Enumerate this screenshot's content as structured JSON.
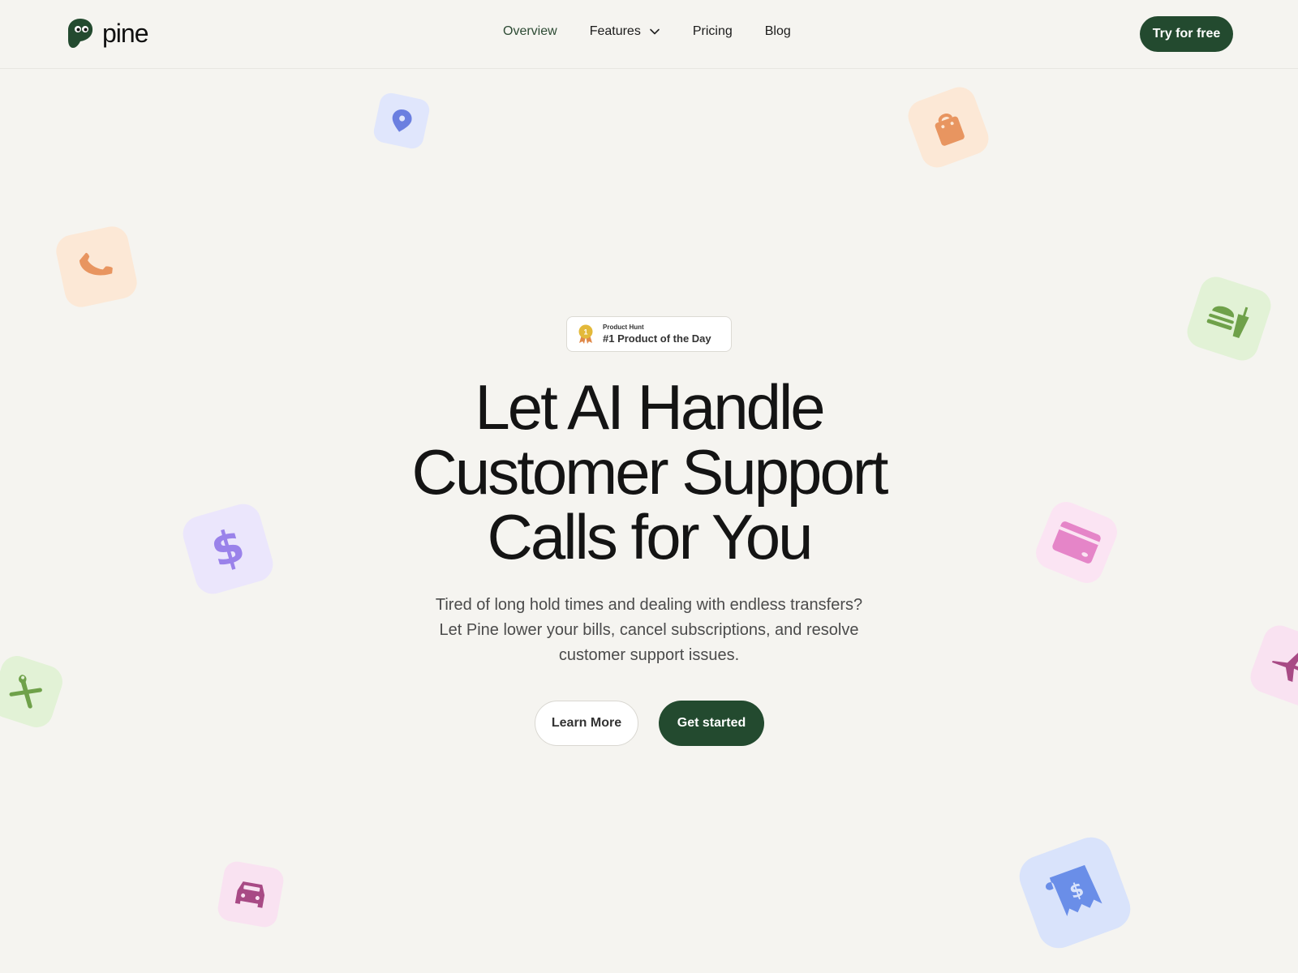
{
  "brand": {
    "name": "pine",
    "color": "#234a2f"
  },
  "nav": {
    "links": [
      {
        "label": "Overview",
        "active": true
      },
      {
        "label": "Features",
        "has_dropdown": true
      },
      {
        "label": "Pricing"
      },
      {
        "label": "Blog"
      }
    ],
    "cta_label": "Try for free"
  },
  "badge": {
    "small_label": "Product Hunt",
    "main_label": "#1 Product of the Day",
    "medal_number": "1"
  },
  "hero": {
    "title_lines": [
      "Let AI Handle",
      "Customer Support",
      "Calls for You"
    ],
    "subtitle_lines": [
      "Tired of long hold times and dealing with endless transfers?",
      "Let Pine lower your bills, cancel subscriptions, and resolve",
      "customer support issues."
    ],
    "secondary_button": "Learn More",
    "primary_button": "Get started"
  },
  "decor_icons": [
    {
      "name": "location-pin-icon",
      "color": "#6b7fe0",
      "bg": "#e0e6fc"
    },
    {
      "name": "shopping-bag-icon",
      "color": "#e89560",
      "bg": "#fce8d6"
    },
    {
      "name": "phone-icon",
      "color": "#e89560",
      "bg": "#fce8d6"
    },
    {
      "name": "burger-drink-icon",
      "color": "#6fa14a",
      "bg": "#e2f2d6"
    },
    {
      "name": "dollar-icon",
      "color": "#9a82ea",
      "bg": "#ebe6fc"
    },
    {
      "name": "credit-card-icon",
      "color": "#e585c8",
      "bg": "#fbe4f3"
    },
    {
      "name": "tools-icon",
      "color": "#6fa14a",
      "bg": "#e2f2d6"
    },
    {
      "name": "airplane-icon",
      "color": "#a84a85",
      "bg": "#f9e2f1"
    },
    {
      "name": "car-icon",
      "color": "#a84a85",
      "bg": "#f9e2f1"
    },
    {
      "name": "receipt-icon",
      "color": "#6a8ee8",
      "bg": "#d9e3fb"
    }
  ]
}
